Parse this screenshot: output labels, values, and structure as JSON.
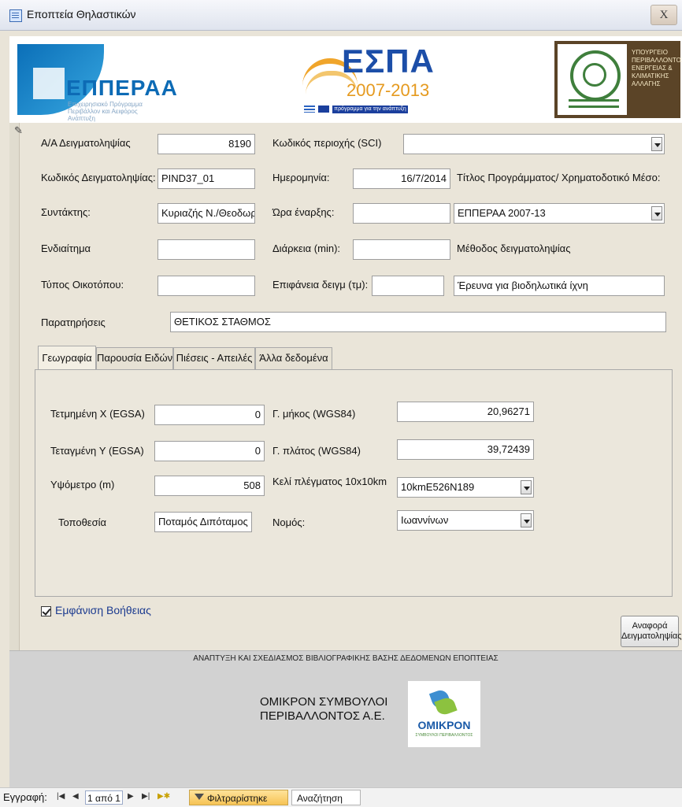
{
  "window": {
    "title": "Εποπτεία Θηλαστικών",
    "close_label": "X"
  },
  "banner": {
    "epperaa": {
      "name": "ΕΠΠΕΡΑΑ",
      "sub": "Επιχειρησιακό Πρόγραμμα Περιβάλλον και Αειφόρος Ανάπτυξη"
    },
    "espa": {
      "name": "ΕΣΠΑ",
      "years": "2007-2013",
      "tagline": "πρόγραμμα για την ανάπτυξη"
    },
    "ministry": {
      "text": "ΥΠΟΥΡΓΕΙΟ ΠΕΡΙΒΑΛΛΟΝΤΟΣ ΕΝΕΡΓΕΙΑΣ & ΚΛΙΜΑΤΙΚΗΣ ΑΛΛΑΓΗΣ"
    }
  },
  "form": {
    "aa_label": "Α/Α Δειγματοληψίας",
    "aa_value": "8190",
    "sci_label": "Κωδικός περιοχής (SCI)",
    "sci_value": "",
    "code_label": "Κωδικός Δειγματοληψίας:",
    "code_value": "PIND37_01",
    "date_label": "Ημερομηνία:",
    "date_value": "16/7/2014",
    "program_label": "Τίτλος Προγράμματος/ Χρηματοδοτικό Μέσο:",
    "author_label": "Συντάκτης:",
    "author_value": "Κυριαζής Ν./Θεοδωρότ",
    "start_label": "Ώρα έναρξης:",
    "start_value": "",
    "program_value": "ΕΠΠΕΡΑΑ 2007-13",
    "habitat_label": "Ενδιαίτημα",
    "habitat_value": "",
    "duration_label": "Διάρκεια (min):",
    "duration_value": "",
    "method_label": "Μέθοδος δειγματοληψίας",
    "habitat_type_label": "Τύπος Οικοτόπου:",
    "habitat_type_value": "",
    "area_label": "Επιφάνεια δειγμ (τμ):",
    "area_value": "",
    "method_value": "Έρευνα για βιοδηλωτικά ίχνη",
    "notes_label": "Παρατηρήσεις",
    "notes_value": "ΘΕΤΙΚΟΣ ΣΤΑΘΜΟΣ"
  },
  "tabs": [
    {
      "label": "Γεωγραφία"
    },
    {
      "label": "Παρουσία Ειδών"
    },
    {
      "label": "Πιέσεις - Απειλές"
    },
    {
      "label": "Άλλα δεδομένα"
    }
  ],
  "geo": {
    "x_label": "Τετμημένη X (EGSA)",
    "x_value": "0",
    "lon_label": "Γ. μήκος (WGS84)",
    "lon_value": "20,96271",
    "y_label": "Τεταγμένη Y (EGSA)",
    "y_value": "0",
    "lat_label": "Γ. πλάτος (WGS84)",
    "lat_value": "39,72439",
    "alt_label": "Υψόμετρο (m)",
    "alt_value": "508",
    "grid_label": "Κελί πλέγματος 10x10km",
    "grid_value": "10kmE526N189",
    "loc_label": "Τοποθεσία",
    "loc_value": "Ποταμός Διπόταμος - Ι",
    "pref_label": "Νομός:",
    "pref_value": "Ιωαννίνων"
  },
  "help": {
    "label": "Εμφάνιση Βοήθειας",
    "checked": true
  },
  "report_button": {
    "line1": "Αναφορά",
    "line2": "Δειγματοληψίας"
  },
  "footer": {
    "title": "ΑΝΑΠΤΥΞΗ ΚΑΙ ΣΧΕΔΙΑΣΜΟΣ ΒΙΒΛΙΟΓΡΑΦΙΚΗΣ ΒΑΣΗΣ ΔΕΔΟΜΕΝΩΝ ΕΠΟΠΤΕΙΑΣ",
    "company_line1": "ΟΜΙΚΡΟΝ ΣΥΜΒΟΥΛΟΙ",
    "company_line2": "ΠΕΡΙΒΑΛΛΟΝΤΟΣ Α.Ε.",
    "logo_word": "OMIKPON",
    "logo_tag": "ΣΥΜΒΟΥΛΟΙ ΠΕΡΙΒΑΛΛΟΝΤΟΣ"
  },
  "navbar": {
    "record_label": "Εγγραφή:",
    "position": "1 από 1",
    "filter_label": "Φιλτραρίστηκε",
    "search_label": "Αναζήτηση"
  }
}
